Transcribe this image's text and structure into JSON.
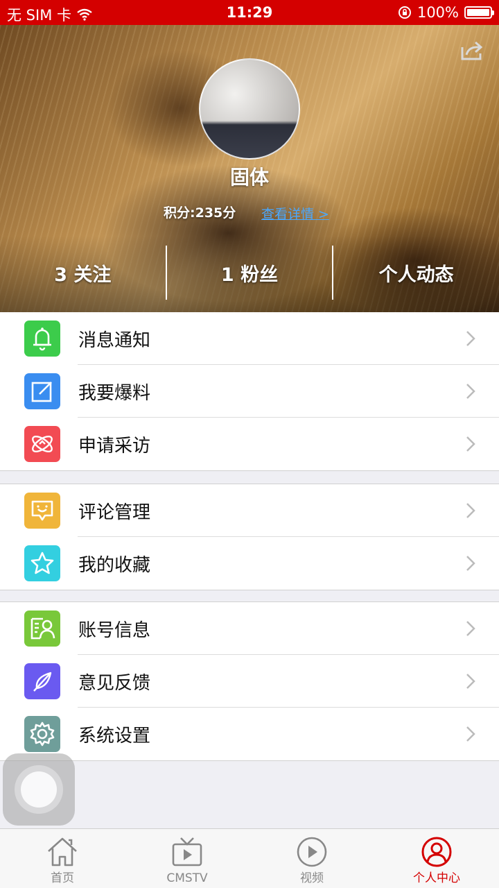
{
  "status_bar": {
    "carrier": "无 SIM 卡",
    "time": "11:29",
    "battery": "100%"
  },
  "profile": {
    "username": "固体",
    "points": "积分:235分",
    "details_link": "查看详情 >",
    "stats": {
      "following": "3 关注",
      "followers": "1 粉丝",
      "activity": "个人动态"
    }
  },
  "menu_groups": [
    [
      {
        "label": "消息通知",
        "icon": "bell-icon",
        "color": "#3ccc4b"
      },
      {
        "label": "我要爆料",
        "icon": "edit-icon",
        "color": "#3a8df0"
      },
      {
        "label": "申请采访",
        "icon": "interview-icon",
        "color": "#f24b53"
      }
    ],
    [
      {
        "label": "评论管理",
        "icon": "comment-icon",
        "color": "#f0b53a"
      },
      {
        "label": "我的收藏",
        "icon": "star-icon",
        "color": "#33cfe0"
      }
    ],
    [
      {
        "label": "账号信息",
        "icon": "account-icon",
        "color": "#79c83a"
      },
      {
        "label": "意见反馈",
        "icon": "feather-icon",
        "color": "#6a5af0"
      },
      {
        "label": "系统设置",
        "icon": "settings-icon",
        "color": "#6f9e9a"
      }
    ]
  ],
  "tabs": [
    {
      "label": "首页",
      "icon": "home-icon"
    },
    {
      "label": "CMSTV",
      "icon": "tv-icon"
    },
    {
      "label": "视频",
      "icon": "play-icon"
    },
    {
      "label": "个人中心",
      "icon": "profile-icon",
      "active": true
    }
  ],
  "colors": {
    "brand": "#d40000",
    "link": "#4aa8ff"
  }
}
